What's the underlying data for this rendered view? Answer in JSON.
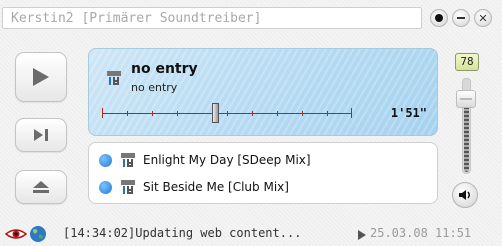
{
  "window": {
    "title": "Kerstin2 [Primärer Soundtreiber]"
  },
  "now_playing": {
    "title": "no entry",
    "subtitle": "no entry",
    "time": "1'51\"",
    "seek_fraction": 0.45
  },
  "playlist": {
    "items": [
      {
        "label": "Enlight My Day [SDeep Mix]"
      },
      {
        "label": "Sit Beside Me [Club Mix]"
      }
    ]
  },
  "volume": {
    "value": "78",
    "fraction": 0.78
  },
  "status": {
    "message": "[14:34:02]Updating web content...",
    "date": "25.03.08 11:51"
  },
  "icons": {
    "titlebar": [
      "record-icon",
      "minimize-icon",
      "close-icon"
    ],
    "controls": [
      "play-icon",
      "next-track-icon",
      "eject-icon"
    ],
    "track": "music-note-icon",
    "speaker": "speaker-icon",
    "statusbar": [
      "eye-icon",
      "globe-icon",
      "play-arrow-icon"
    ]
  },
  "colors": {
    "accent_blue": "#a6d2ef",
    "seek_red": "#b8241c",
    "bullet_blue": "#1f78d1",
    "volume_badge": "#d7e39a"
  }
}
